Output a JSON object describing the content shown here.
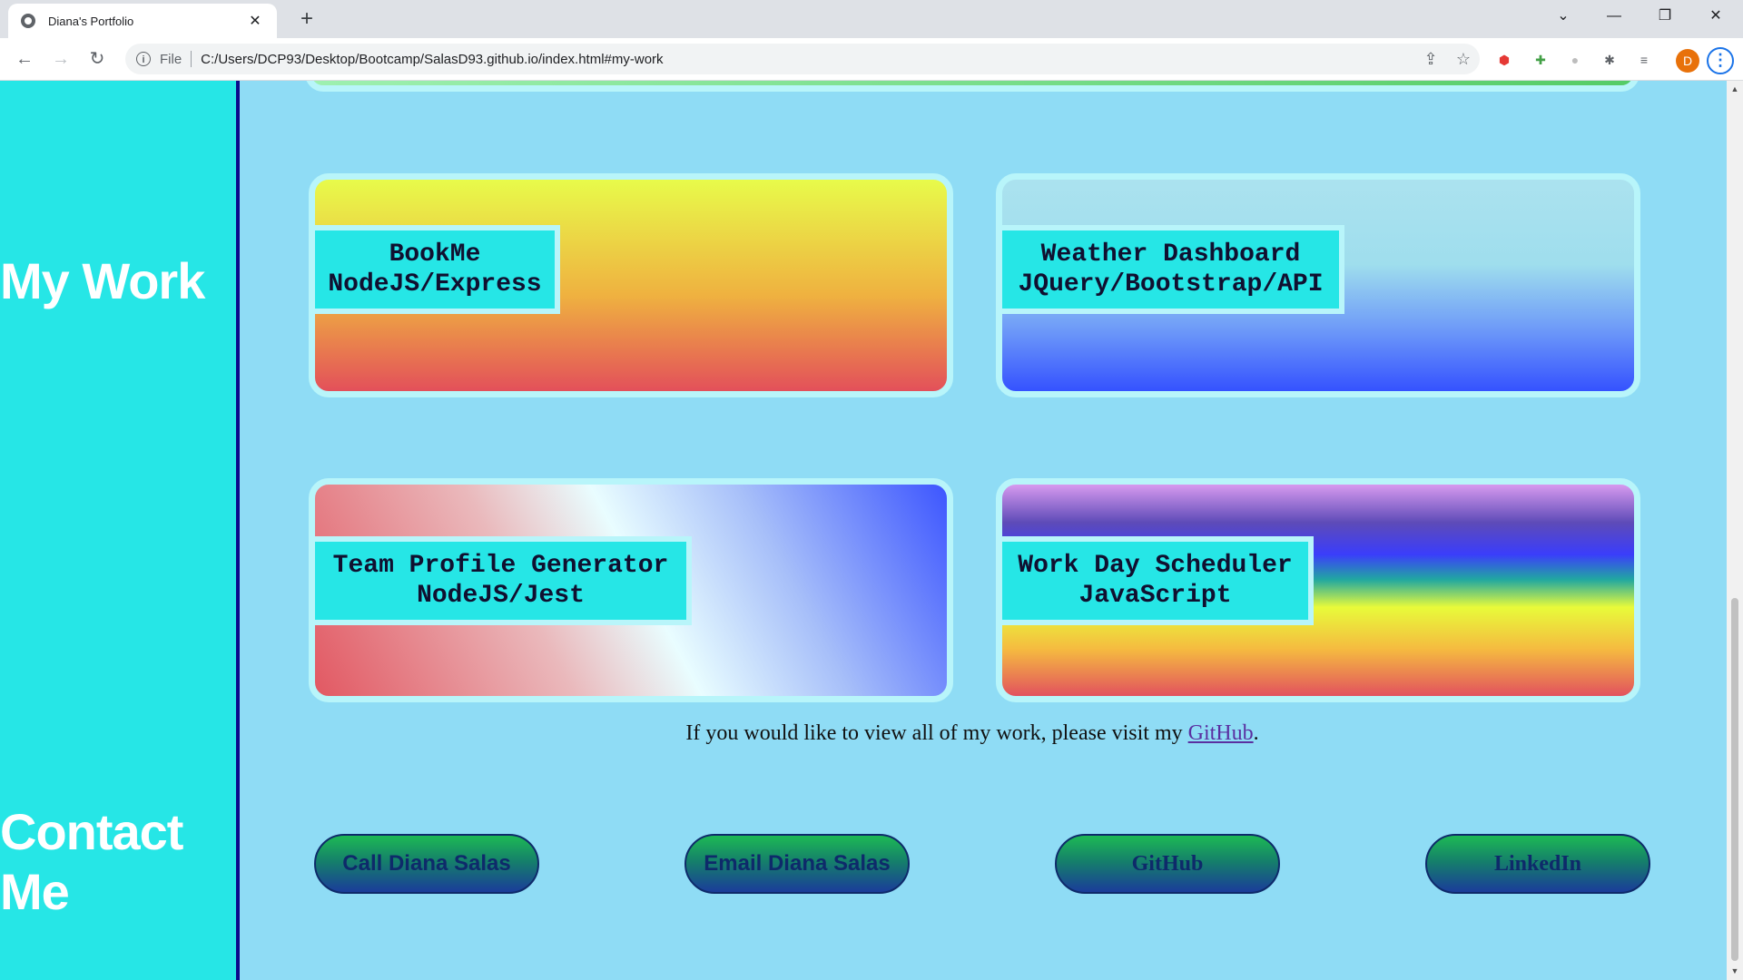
{
  "browser": {
    "tab_title": "Diana's Portfolio",
    "tab_close": "✕",
    "new_tab": "+",
    "scheme_label": "File",
    "url": "C:/Users/DCP93/Desktop/Bootcamp/SalasD93.github.io/index.html#my-work",
    "profile_initial": "D"
  },
  "sidebar": {
    "my_work": "My Work",
    "contact_me_line1": "Contact",
    "contact_me_line2": "Me"
  },
  "projects": [
    {
      "name": "BookMe",
      "tech": "NodeJS/Express"
    },
    {
      "name": "Weather Dashboard",
      "tech": "JQuery/Bootstrap/API"
    },
    {
      "name": "Team Profile Generator",
      "tech": "NodeJS/Jest"
    },
    {
      "name": "Work Day Scheduler",
      "tech": "JavaScript"
    }
  ],
  "visit": {
    "text_before": "If you would like to view all of my work, please visit my ",
    "link_text": "GitHub",
    "text_after": "."
  },
  "contact_buttons": {
    "call": "Call Diana Salas",
    "email": "Email Diana Salas",
    "github": "GitHub",
    "linkedin": "LinkedIn"
  },
  "colors": {
    "page_background": "#8fdcf5",
    "sidebar": "#26e6e6",
    "label_background": "#26e6e6",
    "card_border": "#b8f5fa",
    "sidebar_divider": "#0b0b8a"
  }
}
